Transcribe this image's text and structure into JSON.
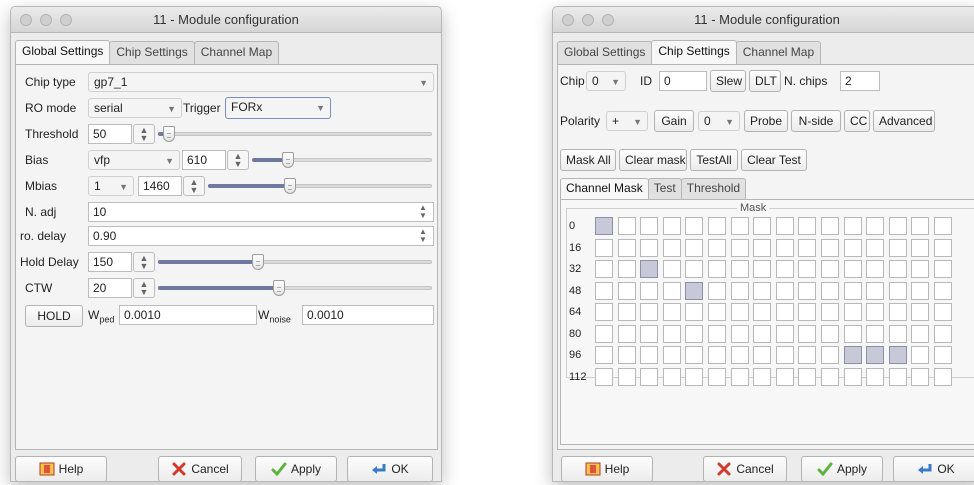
{
  "left_window": {
    "title": "11 - Module configuration",
    "tabs": [
      "Global Settings",
      "Chip Settings",
      "Channel Map"
    ],
    "active_tab": 0,
    "chip_type": {
      "label": "Chip type",
      "value": "gp7_1"
    },
    "ro_mode": {
      "label": "RO mode",
      "value": "serial"
    },
    "trigger": {
      "label": "Trigger",
      "value": "FORx"
    },
    "threshold": {
      "label": "Threshold",
      "value": "50",
      "slider_fraction": 0.02
    },
    "bias": {
      "label": "Bias",
      "value": "vfp",
      "spin_value": "610",
      "slider_fraction": 0.18
    },
    "mbias": {
      "label": "Mbias",
      "value": "1",
      "spin_value": "1460",
      "slider_fraction": 0.36
    },
    "n_adj": {
      "label": "N. adj",
      "value": "10"
    },
    "ro_delay": {
      "label": "ro. delay",
      "value": "0.90"
    },
    "hold_delay": {
      "label": "Hold Delay",
      "value": "150",
      "slider_fraction": 0.36
    },
    "ctw": {
      "label": "CTW",
      "value": "20",
      "slider_fraction": 0.44
    },
    "hold_button": "HOLD",
    "w_ped": {
      "label_main": "W",
      "label_sub": "ped",
      "value": "0.0010"
    },
    "w_noise": {
      "label_main": "W",
      "label_sub": "noise",
      "value": "0.0010"
    },
    "footer": {
      "help": "Help",
      "cancel": "Cancel",
      "apply": "Apply",
      "ok": "OK"
    }
  },
  "right_window": {
    "title": "11 - Module configuration",
    "tabs": [
      "Global Settings",
      "Chip Settings",
      "Channel Map"
    ],
    "active_tab": 1,
    "chip": {
      "label": "Chip",
      "value": "0"
    },
    "id": {
      "label": "ID",
      "value": "0"
    },
    "slew_button": "Slew",
    "dlt_button": "DLT",
    "n_chips": {
      "label": "N. chips",
      "value": "2"
    },
    "polarity": {
      "label": "Polarity",
      "value": "+"
    },
    "gain_button": "Gain",
    "gain_value": "0",
    "probe_button": "Probe",
    "nside_button": "N-side",
    "cc_button": "CC",
    "advanced_button": "Advanced",
    "mask_all_button": "Mask All",
    "clear_mask_button": "Clear mask",
    "test_all_button": "TestAll",
    "clear_test_button": "Clear Test",
    "subtabs": [
      "Channel Mask",
      "Test",
      "Threshold"
    ],
    "active_subtab": 0,
    "mask_title": "Mask",
    "row_labels": [
      "0",
      "16",
      "32",
      "48",
      "64",
      "80",
      "96",
      "112"
    ],
    "checked_cells": [
      [
        0,
        0
      ],
      [
        2,
        2
      ],
      [
        3,
        4
      ],
      [
        6,
        11
      ],
      [
        6,
        12
      ],
      [
        6,
        13
      ]
    ],
    "footer": {
      "help": "Help",
      "cancel": "Cancel",
      "apply": "Apply",
      "ok": "OK"
    }
  }
}
